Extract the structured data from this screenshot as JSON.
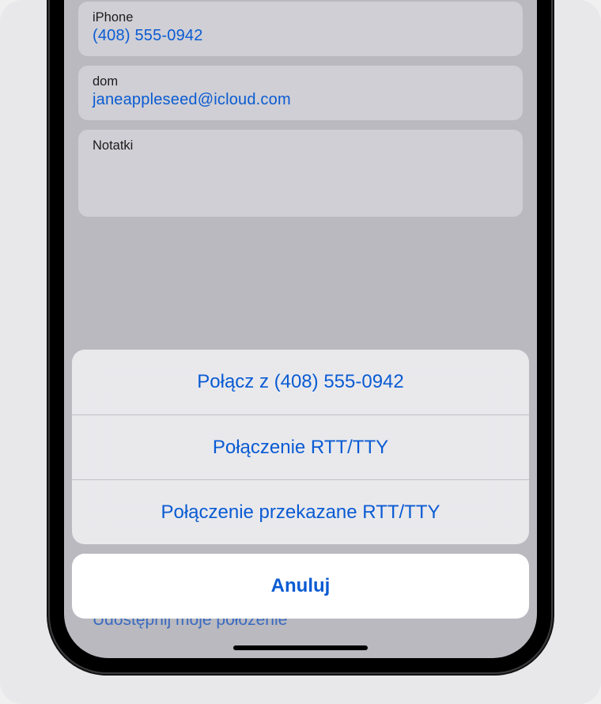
{
  "contact": {
    "phone": {
      "label": "iPhone",
      "value": "(408) 555-0942"
    },
    "email": {
      "label": "dom",
      "value": "janeappleseed@icloud.com"
    },
    "notes": {
      "label": "Notatki"
    },
    "share_location": "Udostępnij moje położenie"
  },
  "action_sheet": {
    "options": [
      "Połącz z (408) 555-0942",
      "Połączenie RTT/TTY",
      "Połączenie przekazane RTT/TTY"
    ],
    "cancel": "Anuluj"
  }
}
